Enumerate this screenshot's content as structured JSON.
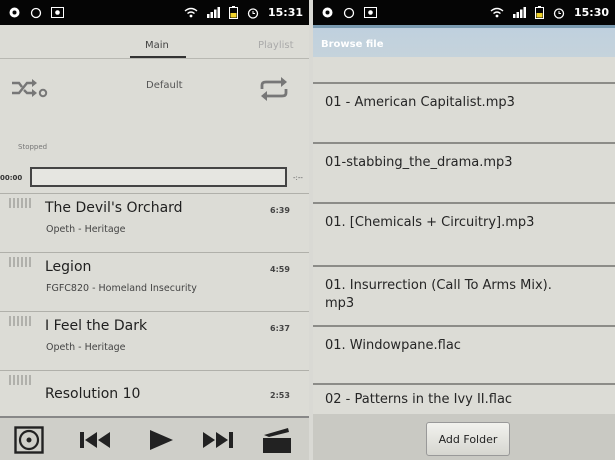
{
  "left": {
    "status": {
      "time": "15:31"
    },
    "tabs": [
      "Main",
      "Playlist"
    ],
    "playlist_name": "Default",
    "playback_status": "Stopped",
    "position_time": "00:00",
    "remaining_time": "-:--",
    "tracks": [
      {
        "title": "The Devil's Orchard",
        "artist": "Opeth - Heritage",
        "duration": "6:39"
      },
      {
        "title": "Legion",
        "artist": "FGFC820 - Homeland Insecurity",
        "duration": "4:59"
      },
      {
        "title": "I Feel the Dark",
        "artist": "Opeth - Heritage",
        "duration": "6:37"
      },
      {
        "title": "Resolution 10",
        "artist": "",
        "duration": "2:53"
      }
    ],
    "icons": {
      "shuffle": "shuffle-icon",
      "repeat": "repeat-icon",
      "disc": "disc-icon",
      "previous": "previous-icon",
      "play": "play-icon",
      "next": "next-icon",
      "folder": "folder-icon"
    }
  },
  "right": {
    "status": {
      "time": "15:30"
    },
    "title": "Browse file",
    "files": [
      "01 - American Capitalist.mp3",
      "01-stabbing_the_drama.mp3",
      "01. [Chemicals + Circuitry].mp3",
      "01. Insurrection (Call To Arms Mix).\nmp3",
      "01. Windowpane.flac",
      "02 - Patterns in the Ivy II.flac"
    ],
    "add_folder_label": "Add Folder"
  },
  "colors": {
    "statusbar": "#050505",
    "background": "#dcdcd6",
    "titlebar": "#c5d3dc",
    "titlebar_text": "#ffffff"
  }
}
